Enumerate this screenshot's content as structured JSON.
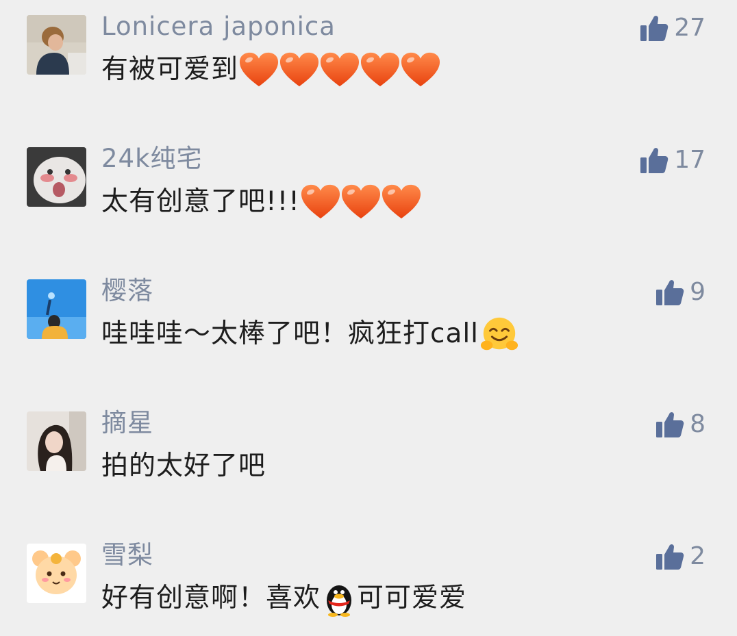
{
  "colors": {
    "background": "#efefef",
    "username": "#7e8a9f",
    "text": "#1d1d1d",
    "icon": "#5a6f9a",
    "heart": "#f25a1f"
  },
  "comments": [
    {
      "username": "Lonicera japonica",
      "text": "有被可爱到",
      "emojis_after": [
        "heart-emoji",
        "heart-emoji",
        "heart-emoji",
        "heart-emoji",
        "heart-emoji"
      ],
      "likes": "27"
    },
    {
      "username": "24k纯宅",
      "text": "太有创意了吧!!!",
      "emojis_after": [
        "heart-emoji",
        "heart-emoji",
        "heart-emoji"
      ],
      "likes": "17"
    },
    {
      "username": "樱落",
      "text": "哇哇哇～太棒了吧！疯狂打call",
      "emojis_after": [
        "hug-emoji"
      ],
      "likes": "9"
    },
    {
      "username": "摘星",
      "text": "拍的太好了吧",
      "emojis_after": [],
      "likes": "8"
    },
    {
      "username": "雪梨",
      "text_before": "好有创意啊！喜欢",
      "emoji_inline": "penguin-emoji",
      "text_after": "可可爱爱",
      "likes": "2"
    }
  ]
}
